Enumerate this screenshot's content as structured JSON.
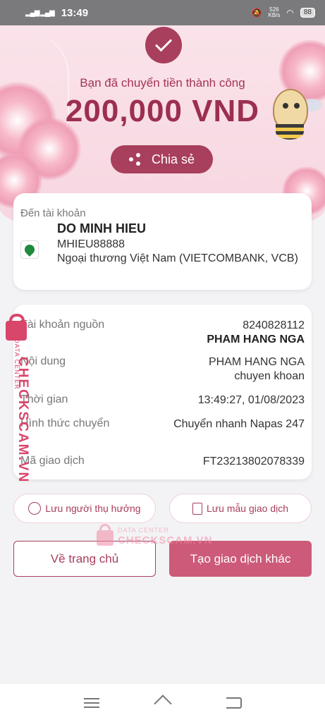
{
  "status_bar": {
    "time": "13:49",
    "signal": "▂▄▆ ▂▄▆",
    "speed_value": "526",
    "speed_unit": "KB/s",
    "battery": "88"
  },
  "header": {
    "success_message": "Bạn đã chuyển tiền thành công",
    "amount": "200,000 VND",
    "share_label": "Chia sẻ"
  },
  "recipient": {
    "label": "Đến tài khoản",
    "name": "DO MINH HIEU",
    "account": "MHIEU88888",
    "bank": "Ngoại thương Việt Nam (VIETCOMBANK, VCB)"
  },
  "details": [
    {
      "key": "Tài khoản nguồn",
      "value": "8240828112",
      "value_bold": "PHAM HANG NGA"
    },
    {
      "key": "Nội dung",
      "value": "PHAM HANG NGA chuyen khoan",
      "value_bold": ""
    },
    {
      "key": "Thời gian",
      "value": "13:49:27, 01/08/2023",
      "value_bold": ""
    },
    {
      "key": "Hình thức chuyển",
      "value": "Chuyển nhanh Napas 247",
      "value_bold": ""
    },
    {
      "key": "Mã giao dịch",
      "value": "FT23213802078339",
      "value_bold": ""
    }
  ],
  "actions": {
    "save_beneficiary": "Lưu người thụ hưởng",
    "save_template": "Lưu mẫu giao dịch",
    "home": "Về trang chủ",
    "new_transaction": "Tạo giao dịch khác"
  },
  "watermark": {
    "small": "DATA CENTER",
    "big": "CHECKSCAM.VN"
  },
  "colors": {
    "brand": "#a83f5c",
    "primary_button": "#cc5a78",
    "hero_bg": "#fbe3ea"
  },
  "icons": {
    "check": "check-icon",
    "share": "share-icon",
    "bank": "vietcombank-logo",
    "user": "user-circle-icon",
    "template": "document-icon"
  }
}
